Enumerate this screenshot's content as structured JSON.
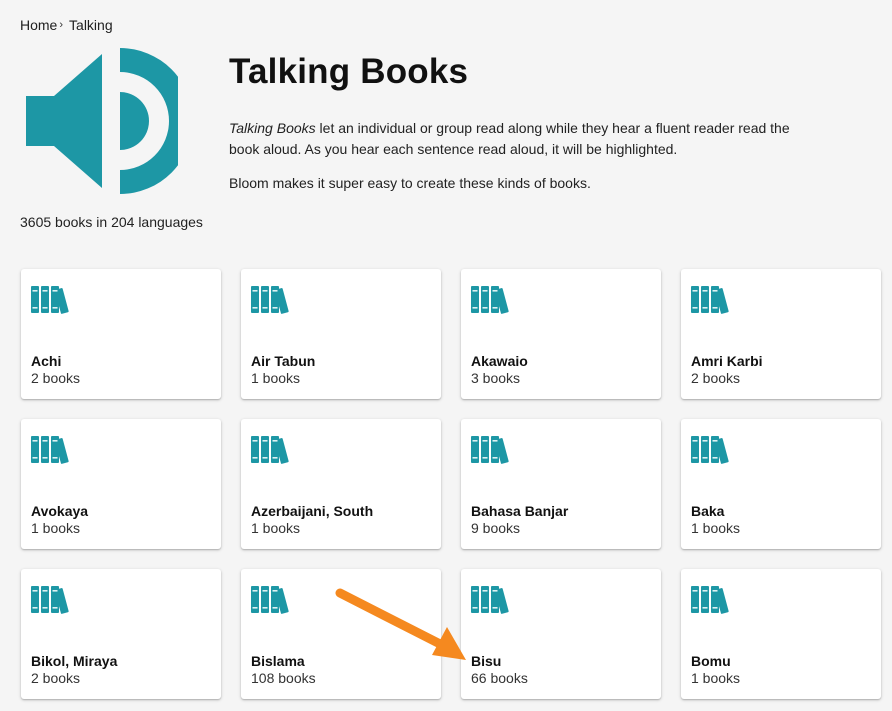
{
  "breadcrumb": {
    "home": "Home",
    "separator": "›",
    "current": "Talking"
  },
  "header": {
    "title": "Talking Books",
    "description_emphasis": "Talking Books",
    "description_rest": " let an individual or group read along while they hear a fluent reader read the book aloud. As you hear each sentence read aloud, it will be highlighted.",
    "description2": "Bloom makes it super easy to create these kinds of books.",
    "count": "3605 books in 204 languages"
  },
  "icons": {
    "hero": "speaker-sound-icon",
    "card": "books-icon"
  },
  "colors": {
    "accent": "#1d97a5",
    "arrow": "#f5891f",
    "background": "#f5f5f5"
  },
  "languages": [
    {
      "name": "Achi",
      "count": "2 books"
    },
    {
      "name": "Air Tabun",
      "count": "1 books"
    },
    {
      "name": "Akawaio",
      "count": "3 books"
    },
    {
      "name": "Amri Karbi",
      "count": "2 books"
    },
    {
      "name": "Avokaya",
      "count": "1 books"
    },
    {
      "name": "Azerbaijani, South",
      "count": "1 books"
    },
    {
      "name": "Bahasa Banjar",
      "count": "9 books"
    },
    {
      "name": "Baka",
      "count": "1 books"
    },
    {
      "name": "Bikol, Miraya",
      "count": "2 books"
    },
    {
      "name": "Bislama",
      "count": "108 books"
    },
    {
      "name": "Bisu",
      "count": "66 books"
    },
    {
      "name": "Bomu",
      "count": "1 books"
    }
  ]
}
